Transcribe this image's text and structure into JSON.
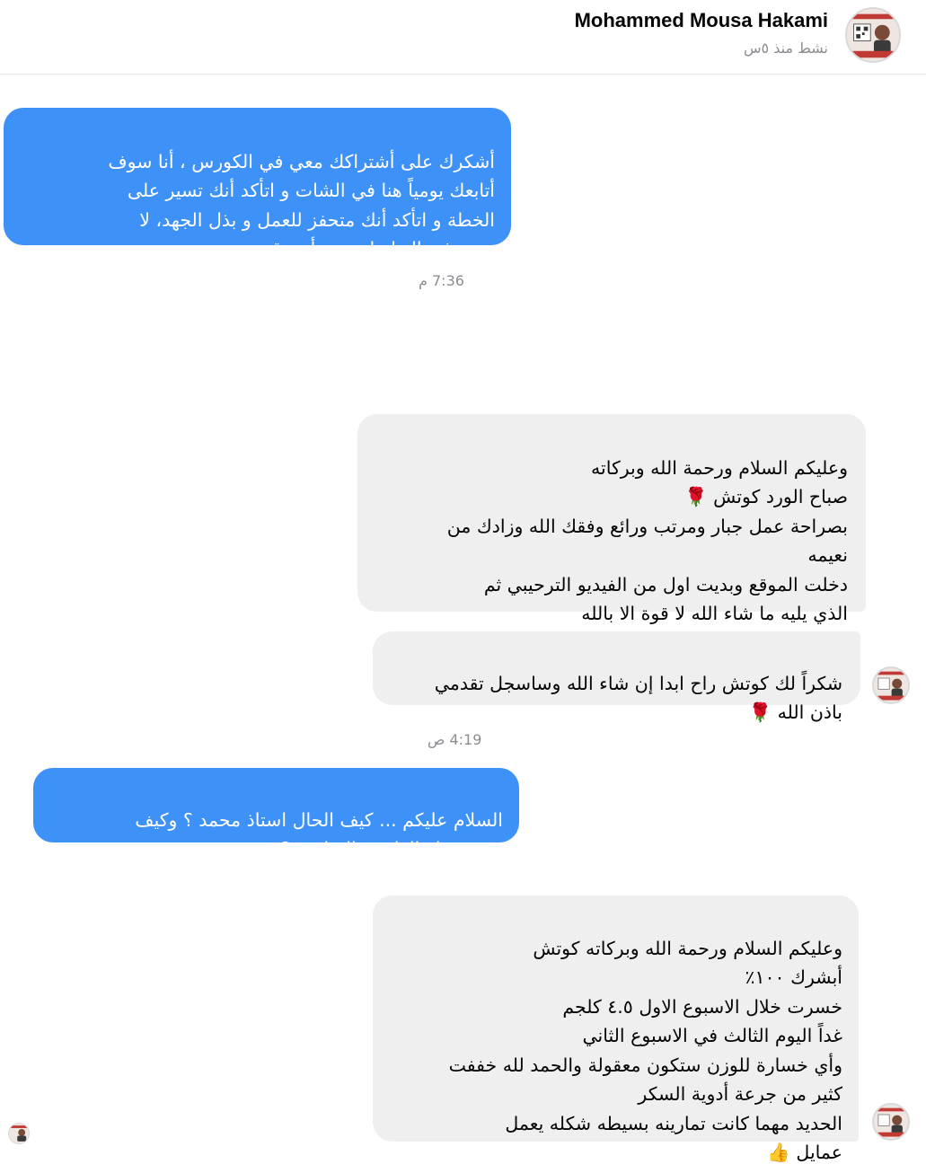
{
  "header": {
    "contact_name": "Mohammed Mousa Hakami",
    "active_status": "نشط منذ ٥س",
    "avatar_icon": "profile-photo-icon"
  },
  "messages": [
    {
      "direction": "outgoing",
      "text": "أشكرك على أشتراكك معي في الكورس ، أنا سوف\nأتابعك يومياً هنا في الشات و اتأكد أنك تسير على\nالخطة و اتأكد أنك متحفز للعمل و بذل الجهد، لا\nتتردد في التواصل معي أي وقت."
    },
    {
      "timestamp": "7:36 م"
    },
    {
      "direction": "incoming",
      "text": "وعليكم السلام ورحمة الله وبركاته\nصباح الورد كوتش 🌹\nبصراحة عمل جبار ومرتب ورائع وفقك الله وزادك من\nنعيمه\nدخلت الموقع وبديت اول من الفيديو الترحيبي ثم\nالذي يليه ما شاء الله لا قوة الا بالله"
    },
    {
      "direction": "incoming",
      "text": "شكراً لك كوتش راح ابدا إن شاء الله وساسجل تقدمي\nباذن الله 🌹"
    },
    {
      "timestamp": "4:19 ص"
    },
    {
      "direction": "outgoing",
      "text": "السلام عليكم ... كيف الحال استاذ محمد ؟ وكيف\nيسير معك الدايت والتمارين ؟"
    },
    {
      "direction": "incoming",
      "text": "وعليكم السلام ورحمة الله وبركاته كوتش\nأبشرك ١٠٠٪\nخسرت خلال الاسبوع الاول ٤.٥ كلجم\nغداً اليوم الثالث في الاسبوع الثاني\nوأي خسارة للوزن ستكون معقولة والحمد لله خففت\nكثير من جرعة أدوية السكر\nالحديد مهما كانت تمارينه بسيطه شكله يعمل\nعمايل 👍"
    }
  ],
  "colors": {
    "outgoing_bubble": "#3e91f6",
    "incoming_bubble": "#efefef",
    "timestamp_text": "#8a8d91"
  }
}
